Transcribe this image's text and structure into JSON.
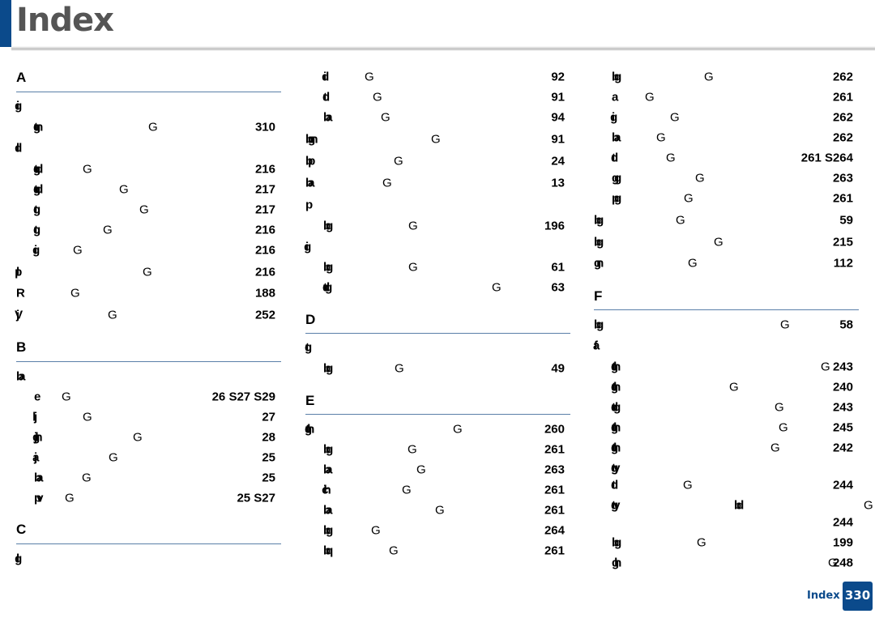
{
  "header": {
    "title": "Index",
    "accent_color": "#0b4a8b"
  },
  "footer": {
    "label": "Index",
    "page": "330"
  },
  "columns": [
    {
      "sections": [
        {
          "letter": "A",
          "entries": [
            {
              "label": "ig",
              "marker": "",
              "page": ""
            },
            {
              "label": "tgn",
              "marker": "G",
              "page": "310"
            },
            {
              "label": "ld",
              "marker": "",
              "page": ""
            },
            {
              "label": "tgd",
              "marker": "G",
              "page": "216"
            },
            {
              "label": "tgd",
              "marker": "G",
              "page": "217"
            },
            {
              "label": "tg",
              "marker": "G",
              "page": "217"
            },
            {
              "label": "tg",
              "marker": "G",
              "page": "216"
            },
            {
              "label": "ig",
              "marker": "G",
              "page": "216"
            },
            {
              "label": "lp",
              "marker": "G",
              "page": "216"
            },
            {
              "label": "R",
              "marker": "G",
              "page": "188"
            },
            {
              "label": "jV",
              "marker": "G",
              "page": "252"
            }
          ]
        },
        {
          "letter": "B",
          "entries": [
            {
              "label": "ba",
              "marker": "",
              "page": ""
            },
            {
              "label": "e",
              "marker": "G",
              "page": "26 S27 S29"
            },
            {
              "label": "jl",
              "marker": "G",
              "page": "27"
            },
            {
              "label": "jgh",
              "marker": "G",
              "page": "28"
            },
            {
              "label": "ja",
              "marker": "G",
              "page": "25"
            },
            {
              "label": "ba",
              "marker": "G",
              "page": "25"
            },
            {
              "label": "pv",
              "marker": "G",
              "page": "25 S27"
            }
          ]
        },
        {
          "letter": "C",
          "entries": [
            {
              "label": "lg",
              "marker": "",
              "page": ""
            }
          ]
        }
      ]
    },
    {
      "sections": [
        {
          "letter": "",
          "entries": [
            {
              "label": "id",
              "marker": "G",
              "page": "92"
            },
            {
              "label": "td",
              "marker": "G",
              "page": "91"
            },
            {
              "label": "ba",
              "marker": "G",
              "page": "94"
            },
            {
              "label": "bgn",
              "marker": "G",
              "page": "91"
            },
            {
              "label": "bp",
              "marker": "G",
              "page": "24"
            },
            {
              "label": "ba",
              "marker": "G",
              "page": "13"
            },
            {
              "label": "p",
              "marker": "",
              "page": ""
            },
            {
              "label": "bg",
              "marker": "G",
              "page": "196"
            },
            {
              "label": "ig",
              "marker": "",
              "page": ""
            },
            {
              "label": "bg",
              "marker": "G",
              "page": "61"
            },
            {
              "label": "tdg",
              "marker": "G",
              "page": "63"
            }
          ]
        },
        {
          "letter": "D",
          "entries": [
            {
              "label": "tg",
              "marker": "",
              "page": ""
            },
            {
              "label": "bg",
              "marker": "G",
              "page": "49"
            }
          ]
        },
        {
          "letter": "E",
          "entries": [
            {
              "label": "tgh",
              "marker": "G",
              "page": "260"
            },
            {
              "label": "bg",
              "marker": "G",
              "page": "261"
            },
            {
              "label": "ba",
              "marker": "G",
              "page": "263"
            },
            {
              "label": "ich",
              "marker": "G",
              "page": "261"
            },
            {
              "label": "ba",
              "marker": "G",
              "page": "261"
            },
            {
              "label": "bg",
              "marker": "G",
              "page": "264"
            },
            {
              "label": "bq",
              "marker": "G",
              "page": "261"
            }
          ]
        }
      ]
    },
    {
      "sections": [
        {
          "letter": "",
          "entries": [
            {
              "label": "bg",
              "marker": "G",
              "page": "262"
            },
            {
              "label": "a",
              "marker": "G",
              "page": "261"
            },
            {
              "label": "ig",
              "marker": "G",
              "page": "262"
            },
            {
              "label": "ba",
              "marker": "G",
              "page": "262"
            },
            {
              "label": "td",
              "marker": "G",
              "page": "261 S264"
            },
            {
              "label": "gg",
              "marker": "G",
              "page": "263"
            },
            {
              "label": "pg",
              "marker": "G",
              "page": "261"
            },
            {
              "label": "bg",
              "marker": "G",
              "page": "59"
            },
            {
              "label": "bg",
              "marker": "G",
              "page": "215"
            },
            {
              "label": "gn",
              "marker": "G",
              "page": "112"
            }
          ]
        },
        {
          "letter": "F",
          "entries": [
            {
              "label": "bg",
              "marker": "G",
              "page": "58"
            },
            {
              "label": "fa",
              "marker": "",
              "page": ""
            },
            {
              "label": "tgh",
              "marker": "G",
              "page": "243"
            },
            {
              "label": "tgh",
              "marker": "G",
              "page": "240"
            },
            {
              "label": "tdg",
              "marker": "G",
              "page": "243"
            },
            {
              "label": "tgh",
              "marker": "G",
              "page": "245"
            },
            {
              "label": "tgh",
              "marker": "G",
              "page": "242"
            },
            {
              "label": "tgy",
              "marker": "",
              "page": ""
            },
            {
              "label": "td",
              "marker": "G",
              "page": "244"
            },
            {
              "label": "tgy",
              "marker": "G",
              "page": "",
              "extra": "bd"
            },
            {
              "label": "",
              "marker": "",
              "page": "244"
            },
            {
              "label": "bg",
              "marker": "G",
              "page": "199"
            },
            {
              "label": "gh",
              "marker": "G",
              "page": "248"
            }
          ]
        }
      ]
    }
  ]
}
